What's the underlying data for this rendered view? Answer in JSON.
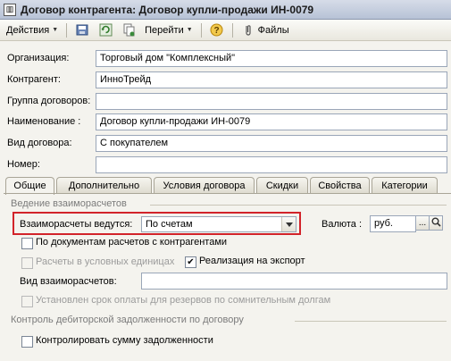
{
  "window": {
    "title": "Договор контрагента: Договор купли-продажи ИН-0079"
  },
  "toolbar": {
    "actions_label": "Действия",
    "goto_label": "Перейти",
    "files_label": "Файлы",
    "help_glyph": "?"
  },
  "form": {
    "org_label": "Организация:",
    "org_value": "Торговый дом \"Комплексный\"",
    "contractor_label": "Контрагент:",
    "contractor_value": "ИнноТрейд",
    "group_label": "Группа договоров:",
    "group_value": "",
    "name_label": "Наименование :",
    "name_value": "Договор купли-продажи ИН-0079",
    "type_label": "Вид договора:",
    "type_value": "С покупателем",
    "number_label": "Номер:",
    "number_value": ""
  },
  "tabs": [
    "Общие",
    "Дополнительно",
    "Условия договора",
    "Скидки",
    "Свойства",
    "Категории"
  ],
  "general": {
    "section_settlements": "Ведение взаиморасчетов",
    "settlements_label": "Взаиморасчеты ведутся:",
    "settlements_value": "По счетам",
    "currency_label": "Валюта :",
    "currency_value": "руб.",
    "cb_by_docs": "По документам расчетов с контрагентами",
    "cb_conv_units": "Расчеты в условных единицах",
    "cb_export": "Реализация на экспорт",
    "settlement_kind_label": "Вид взаиморасчетов:",
    "settlement_kind_value": "",
    "cb_payment_term": "Установлен срок оплаты для резервов по сомнительным долгам",
    "section_debt": "Контроль дебиторской задолженности по договору",
    "cb_control_debt": "Контролировать сумму задолженности",
    "ellipsis": "...",
    "check_glyph": "✔"
  }
}
